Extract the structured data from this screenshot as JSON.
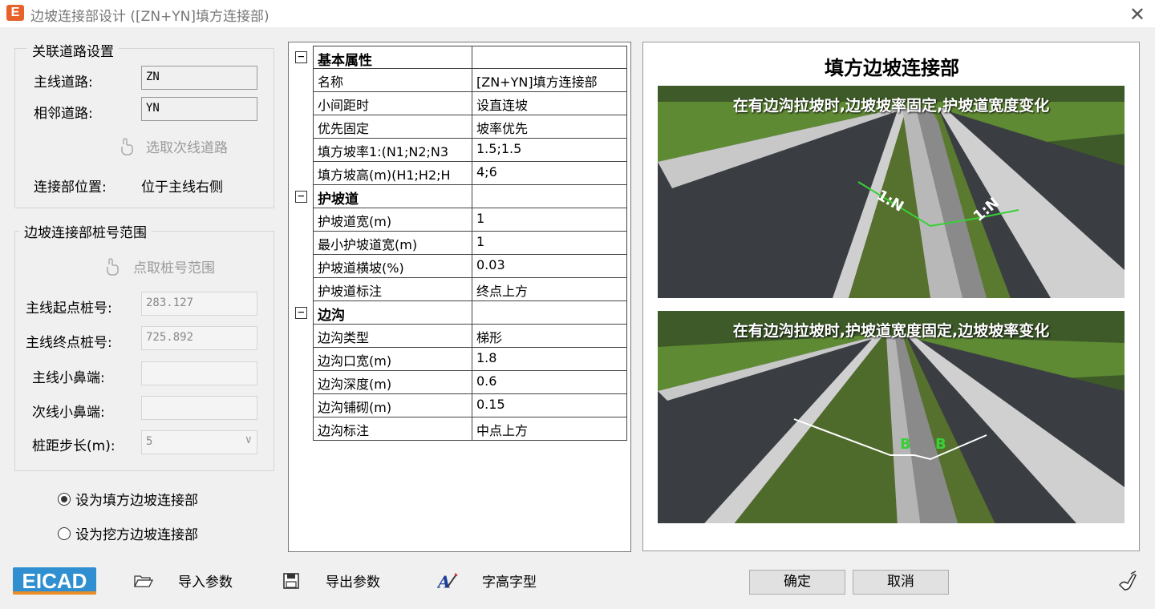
{
  "window": {
    "title": "边坡连接部设计 ([ZN+YN]填方连接部)",
    "logo": "E"
  },
  "road_settings": {
    "group_title": "关联道路设置",
    "main_road_label": "主线道路:",
    "main_road_value": "ZN",
    "adjacent_road_label": "相邻道路:",
    "adjacent_road_value": "YN",
    "pick_secondary_label": "选取次线道路",
    "position_label": "连接部位置:",
    "position_value": "位于主线右侧"
  },
  "station_range": {
    "group_title": "边坡连接部桩号范围",
    "pick_range_label": "点取桩号范围",
    "start_label": "主线起点桩号:",
    "start_value": "283.127",
    "end_label": "主线终点桩号:",
    "end_value": "725.892",
    "main_nose_label": "主线小鼻端:",
    "main_nose_value": "",
    "sub_nose_label": "次线小鼻端:",
    "sub_nose_value": "",
    "step_label": "桩距步长(m):",
    "step_value": "5"
  },
  "mode": {
    "fill_label": "设为填方边坡连接部",
    "cut_label": "设为挖方边坡连接部",
    "selected": "fill"
  },
  "properties": [
    {
      "kind": "category",
      "name": "基本属性",
      "value": ""
    },
    {
      "kind": "prop",
      "name": "名称",
      "value": "[ZN+YN]填方连接部"
    },
    {
      "kind": "prop",
      "name": "小间距时",
      "value": "设直连坡"
    },
    {
      "kind": "prop",
      "name": "优先固定",
      "value": "坡率优先"
    },
    {
      "kind": "prop",
      "name": "填方坡率1:(N1;N2;N3",
      "value": "1.5;1.5"
    },
    {
      "kind": "prop",
      "name": "填方坡高(m)(H1;H2;H",
      "value": "4;6"
    },
    {
      "kind": "category",
      "name": "护坡道",
      "value": ""
    },
    {
      "kind": "prop",
      "name": "护坡道宽(m)",
      "value": "1"
    },
    {
      "kind": "prop",
      "name": "最小护坡道宽(m)",
      "value": "1"
    },
    {
      "kind": "prop",
      "name": "护坡道横坡(%)",
      "value": "0.03"
    },
    {
      "kind": "prop",
      "name": "护坡道标注",
      "value": "终点上方"
    },
    {
      "kind": "category",
      "name": "边沟",
      "value": ""
    },
    {
      "kind": "prop",
      "name": "边沟类型",
      "value": "梯形"
    },
    {
      "kind": "prop",
      "name": "边沟口宽(m)",
      "value": "1.8"
    },
    {
      "kind": "prop",
      "name": "边沟深度(m)",
      "value": "0.6"
    },
    {
      "kind": "prop",
      "name": "边沟铺砌(m)",
      "value": "0.15"
    },
    {
      "kind": "prop",
      "name": "边沟标注",
      "value": "中点上方"
    }
  ],
  "preview": {
    "title": "填方边坡连接部",
    "top_caption": "在有边沟拉坡时,边坡坡率固定,护坡道宽度变化",
    "top_marks": [
      "1:N",
      "1:N"
    ],
    "bottom_caption": "在有边沟拉坡时,护坡道宽度固定,边坡坡率变化",
    "bottom_marks": [
      "B",
      "B"
    ]
  },
  "toolbar": {
    "brand": "EICAD",
    "import_label": "导入参数",
    "export_label": "导出参数",
    "font_label": "字高字型",
    "ok_label": "确定",
    "cancel_label": "取消"
  },
  "colors": {
    "accent_orange": "#e8612a",
    "brand_blue": "#2f8fd0",
    "grass": "#4a6a2a",
    "road": "#3a3d42",
    "mark_green": "#38d038"
  }
}
